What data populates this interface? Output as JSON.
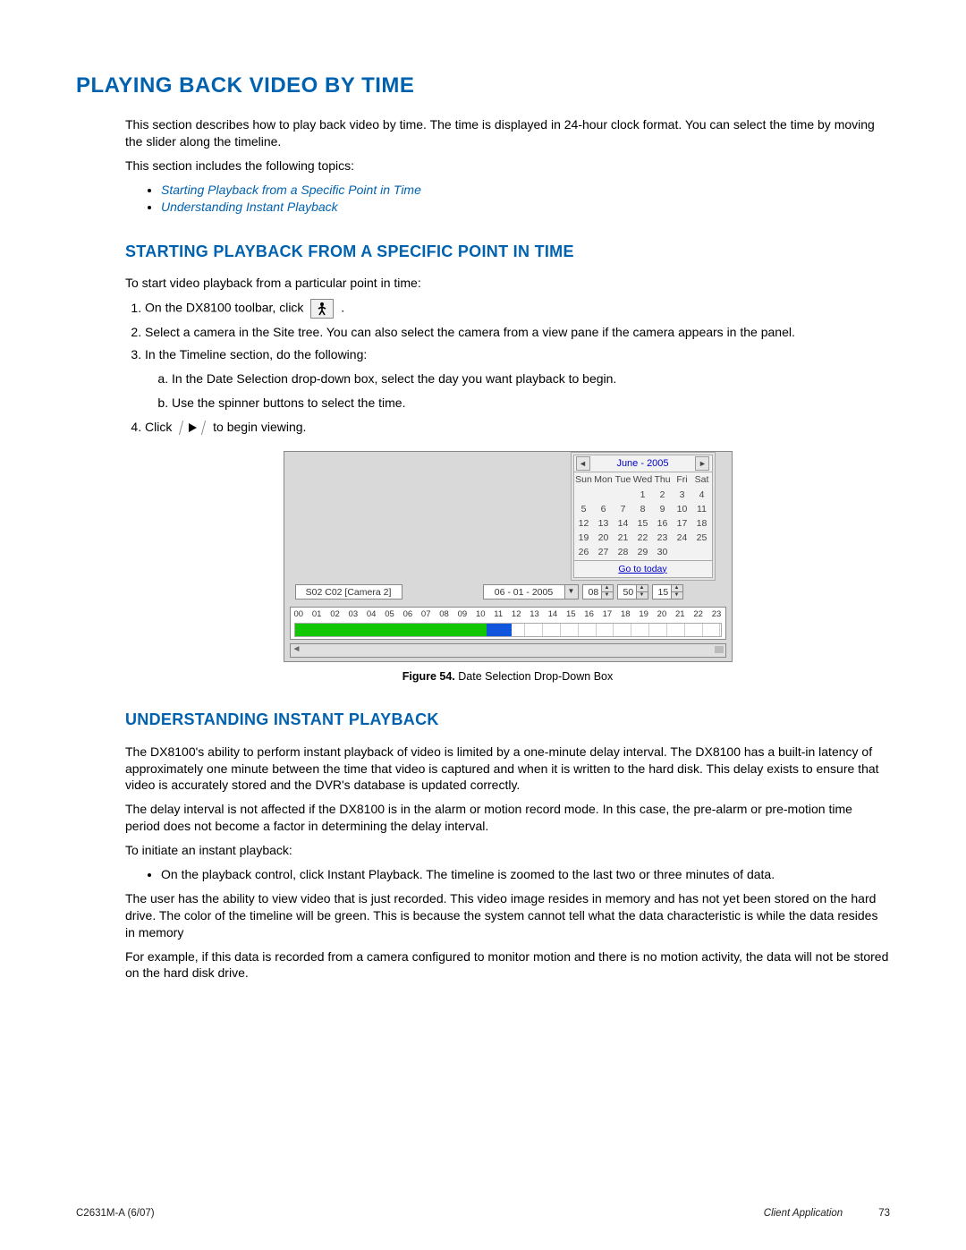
{
  "section_title": "PLAYING BACK VIDEO BY TIME",
  "intro": "This section describes how to play back video by time. The time is displayed in 24-hour clock format. You can select the time by moving the slider along the timeline.",
  "toc_lead": "This section includes the following topics:",
  "toc": [
    "Starting Playback from a Specific Point in Time",
    "Understanding Instant Playback"
  ],
  "sub1_title": "STARTING PLAYBACK FROM A SPECIFIC POINT IN TIME",
  "sub1_lead": "To start video playback from a particular point in time:",
  "step1_pre": "On the DX8100 toolbar, click ",
  "step1_post": " .",
  "step2": "Select a camera in the Site tree. You can also select the camera from a view pane if the camera appears in the panel.",
  "step3": "In the Timeline section, do the following:",
  "step3a": "In the Date Selection drop-down box, select the day you want playback to begin.",
  "step3b": "Use the spinner buttons to select the time.",
  "step4_pre": "Click ",
  "step4_post": " to begin viewing.",
  "figure": {
    "cal_title": "June - 2005",
    "dow": [
      "Sun",
      "Mon",
      "Tue",
      "Wed",
      "Thu",
      "Fri",
      "Sat"
    ],
    "weeks": [
      [
        "",
        "",
        "",
        "1",
        "2",
        "3",
        "4"
      ],
      [
        "5",
        "6",
        "7",
        "8",
        "9",
        "10",
        "11"
      ],
      [
        "12",
        "13",
        "14",
        "15",
        "16",
        "17",
        "18"
      ],
      [
        "19",
        "20",
        "21",
        "22",
        "23",
        "24",
        "25"
      ],
      [
        "26",
        "27",
        "28",
        "29",
        "30",
        "",
        ""
      ]
    ],
    "go_today": "Go to today",
    "camera_field": "S02 C02 [Camera 2]",
    "date_field": "06 - 01 - 2005",
    "spinners": [
      "08",
      "50",
      "15"
    ],
    "hours": [
      "00",
      "01",
      "02",
      "03",
      "04",
      "05",
      "06",
      "07",
      "08",
      "09",
      "10",
      "11",
      "12",
      "13",
      "14",
      "15",
      "16",
      "17",
      "18",
      "19",
      "20",
      "21",
      "22",
      "23"
    ],
    "caption_label": "Figure 54.",
    "caption_text": "  Date Selection Drop-Down Box"
  },
  "sub2_title": "UNDERSTANDING INSTANT PLAYBACK",
  "sub2_p1": "The DX8100's ability to perform instant playback of video is limited by a one-minute delay interval. The DX8100 has a built-in latency of approximately one minute between the time that video is captured and when it is written to the hard disk. This delay exists to ensure that video is accurately stored and the DVR's database is updated correctly.",
  "sub2_p2": "The delay interval is not affected if the DX8100 is in the alarm or motion record mode. In this case, the pre-alarm or pre-motion time period does not become a factor in determining the delay interval.",
  "sub2_lead": "To initiate an instant playback:",
  "sub2_bullet": "On the playback control, click Instant Playback. The timeline is zoomed to the last two or three minutes of data.",
  "sub2_p3": "The user has the ability to view video that is just recorded. This video image resides in memory and has not yet been stored on the hard drive. The color of the timeline will be green. This is because the system cannot tell what the data characteristic is while the data resides in memory",
  "sub2_p4": "For example, if this data is recorded from a camera configured to monitor motion and there is no motion activity, the data will not be stored on the hard disk drive.",
  "footer": {
    "left": "C2631M-A (6/07)",
    "mid": "Client Application",
    "page": "73"
  }
}
